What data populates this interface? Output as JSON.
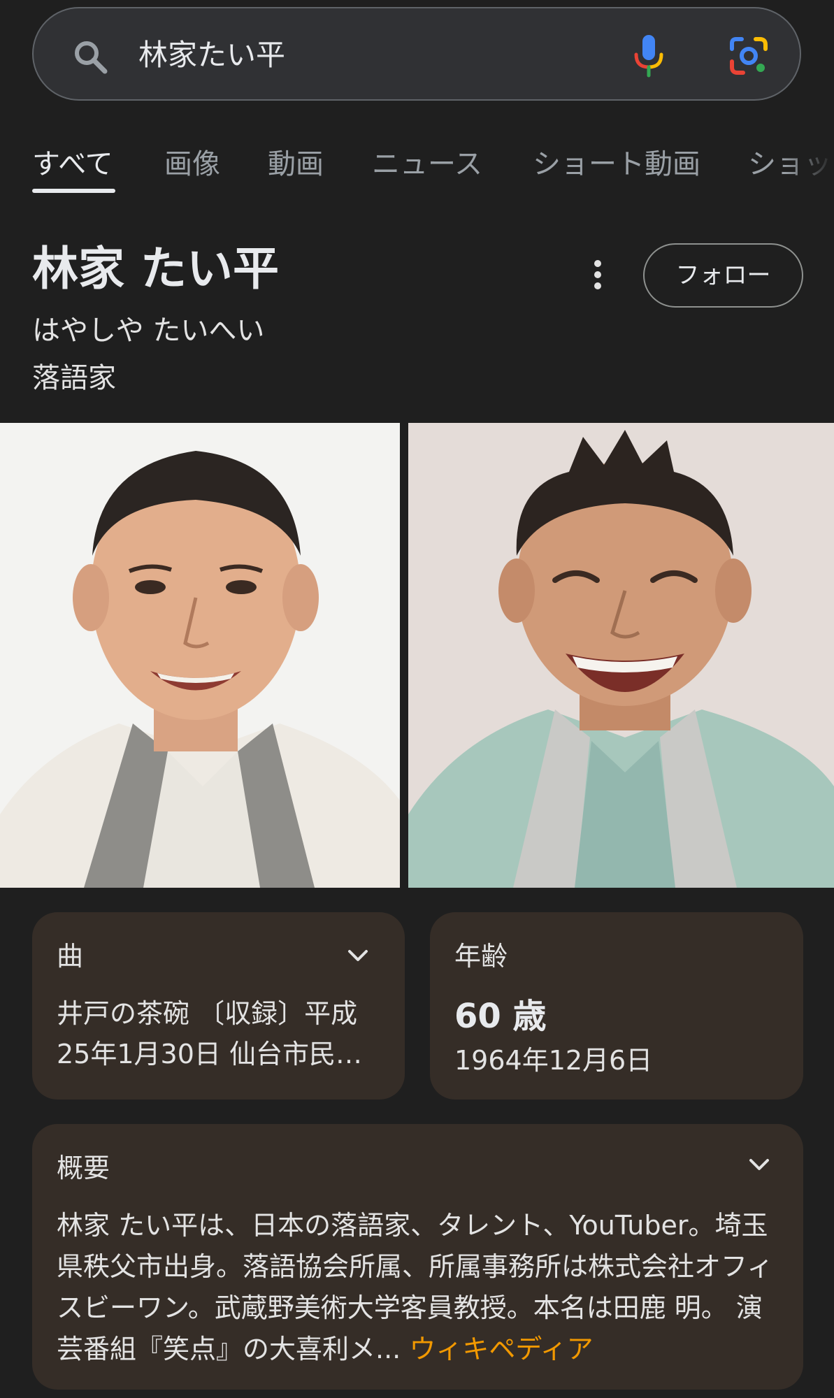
{
  "search": {
    "query": "林家たい平"
  },
  "tabs": [
    {
      "label": "すべて",
      "active": true
    },
    {
      "label": "画像",
      "active": false
    },
    {
      "label": "動画",
      "active": false
    },
    {
      "label": "ニュース",
      "active": false
    },
    {
      "label": "ショート動画",
      "active": false
    },
    {
      "label": "ショッ",
      "active": false
    }
  ],
  "entity": {
    "name": "林家 たい平",
    "reading": "はやしや たいへい",
    "type": "落語家",
    "follow_label": "フォロー",
    "photos": [
      "photo-1",
      "photo-2"
    ]
  },
  "cards": {
    "song": {
      "label": "曲",
      "text": "井戸の茶碗 〔収録〕平成25年1月30日 仙台市民…"
    },
    "age": {
      "label": "年齢",
      "value": "60 歳",
      "birth": "1964年12月6日"
    },
    "overview": {
      "label": "概要",
      "text": "林家 たい平は、日本の落語家、タレント、YouTuber。埼玉県秩父市出身。落語協会所属、所属事務所は株式会社オフィスビーワン。武蔵野美術大学客員教授。本名は田鹿 明。 演芸番組『笑点』の大喜利メ...",
      "source_link": "ウィキペディア"
    }
  },
  "colors": {
    "background": "#1f1f1f",
    "card": "#352d27",
    "link": "#f29900",
    "google_blue": "#4285f4",
    "google_red": "#ea4335",
    "google_yellow": "#fbbc04",
    "google_green": "#34a853"
  },
  "icons": [
    "search-icon",
    "mic-icon",
    "lens-icon",
    "more-vert-icon",
    "chevron-down-icon"
  ]
}
